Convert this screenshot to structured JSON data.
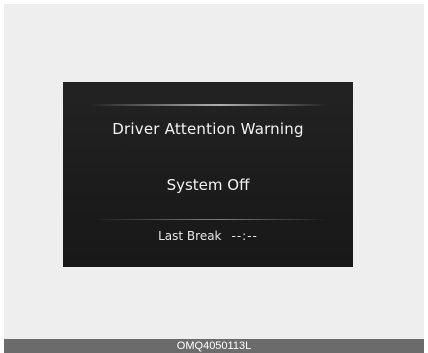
{
  "screen": {
    "title": "Driver Attention Warning",
    "status": "System Off",
    "last_break_label": "Last Break",
    "last_break_value": "--:--"
  },
  "caption": {
    "code": "OMQ4050113L"
  },
  "colors": {
    "screen_background": "#1e1e1e",
    "text": "#f2f2f2",
    "frame_background": "#eeeeee",
    "caption_bar": "#6b6b6b"
  }
}
